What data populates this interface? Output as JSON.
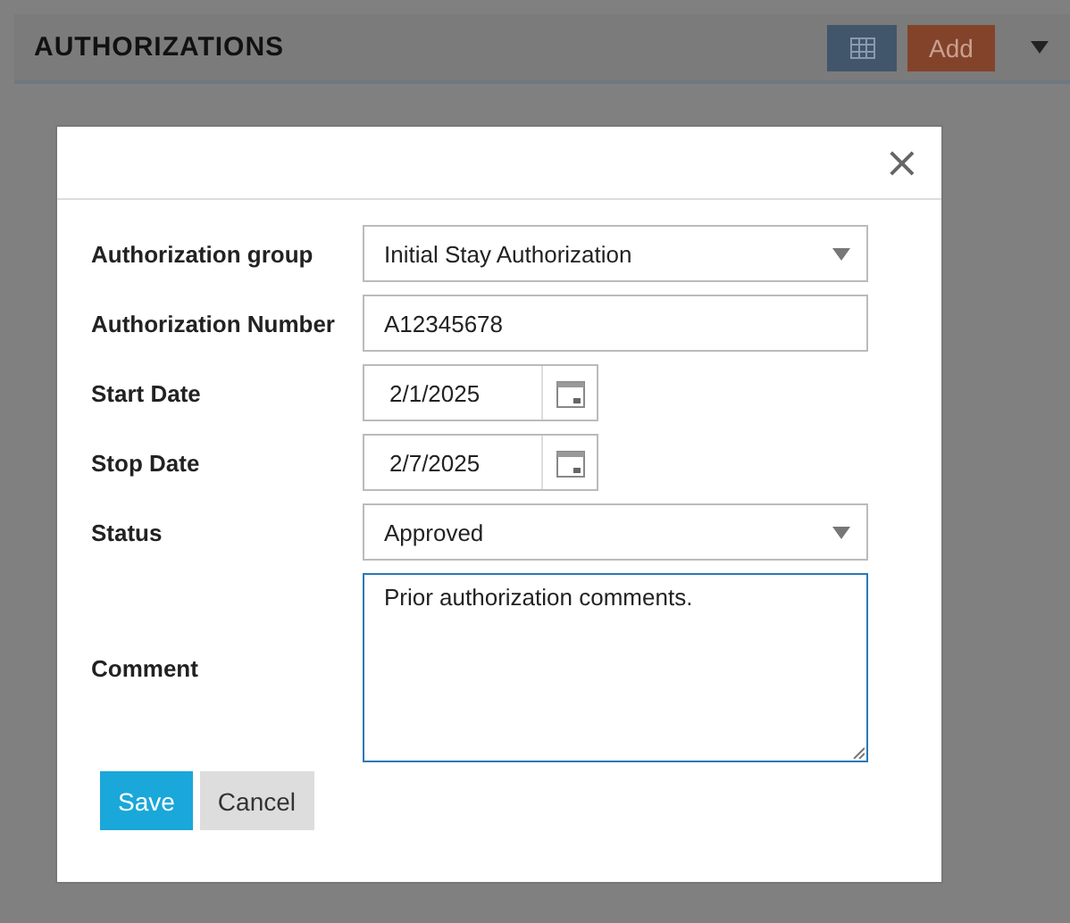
{
  "panel": {
    "title": "AUTHORIZATIONS",
    "add_button": "Add"
  },
  "dialog": {
    "close": "×",
    "fields": [
      {
        "kind": "select",
        "label": "Authorization group",
        "value": "Initial Stay Authorization"
      },
      {
        "kind": "text",
        "label": "Authorization Number",
        "value": "A12345678"
      },
      {
        "kind": "date",
        "label": "Start Date",
        "value": "2/1/2025"
      },
      {
        "kind": "date",
        "label": "Stop Date",
        "value": "2/7/2025"
      },
      {
        "kind": "select",
        "label": "Status",
        "value": "Approved"
      },
      {
        "kind": "textarea",
        "label": "Comment",
        "value": "Prior authorization comments."
      }
    ],
    "buttons": [
      {
        "kind": "primary",
        "label": "Save"
      },
      {
        "kind": "secondary",
        "label": "Cancel"
      }
    ]
  }
}
